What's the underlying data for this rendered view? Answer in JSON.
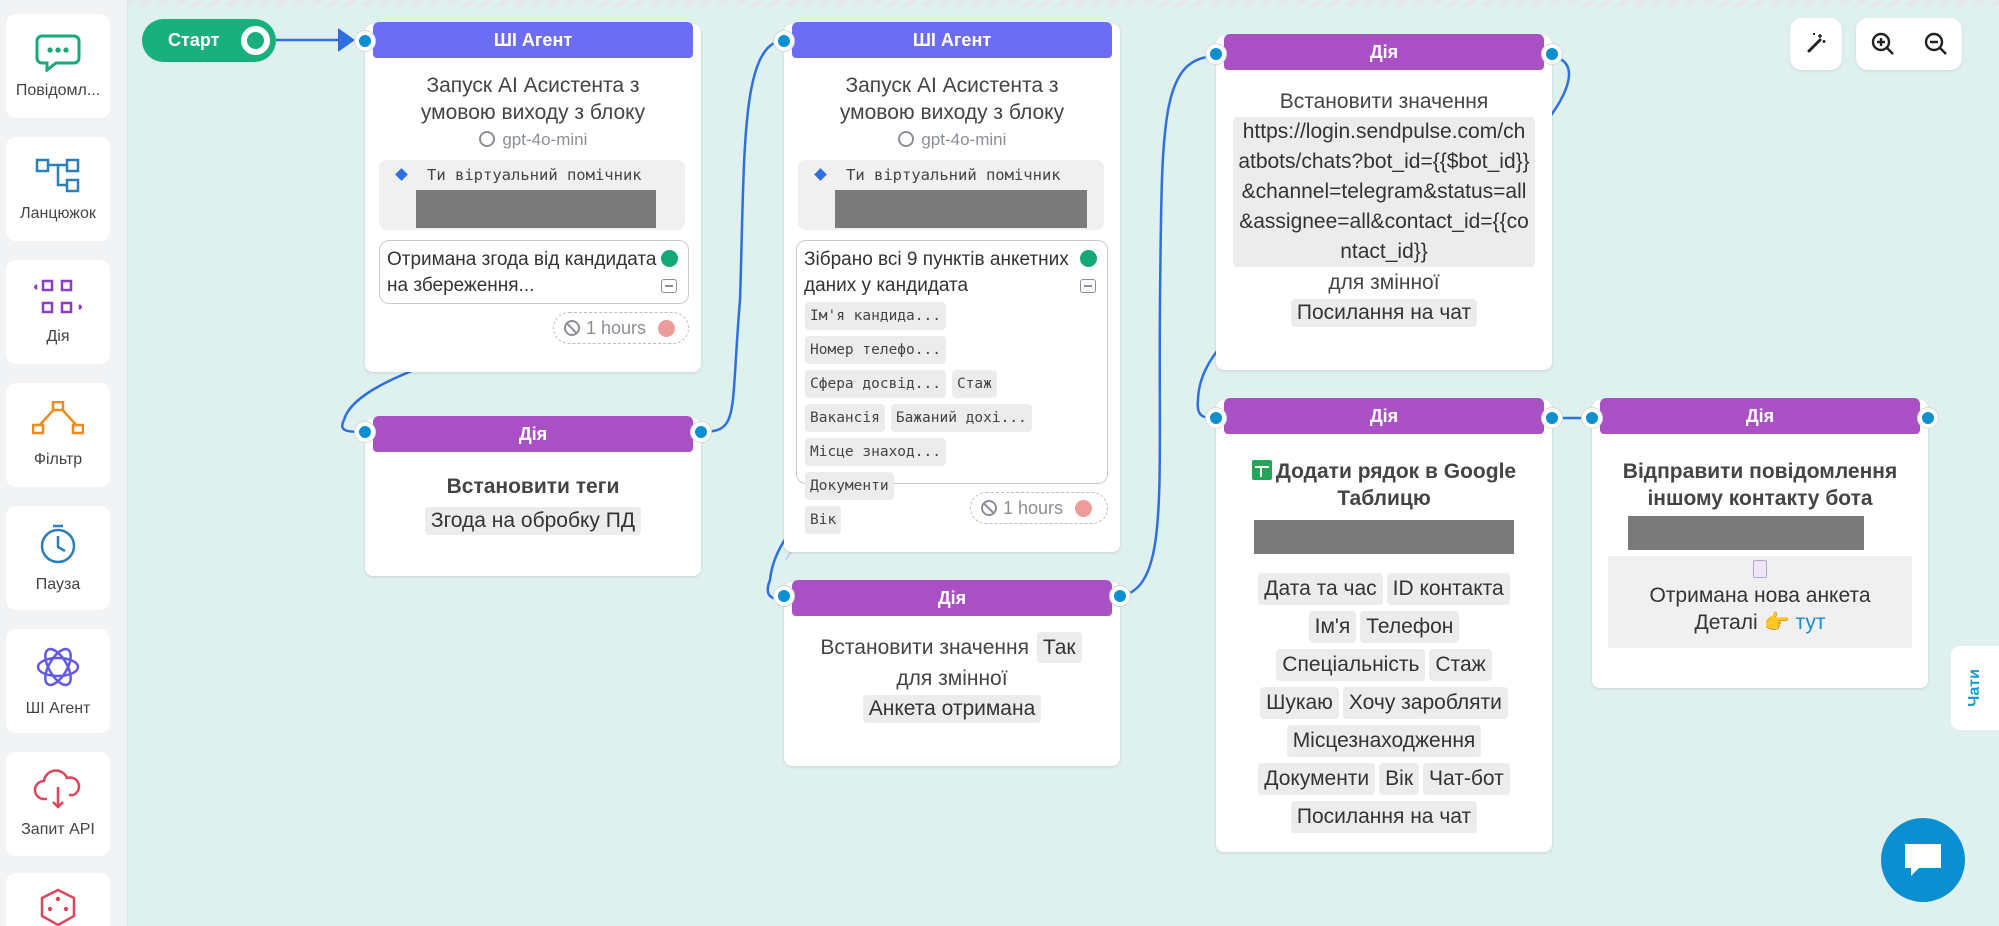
{
  "sidebar": {
    "items": [
      {
        "label": "Повідомл...",
        "icon": "message-icon"
      },
      {
        "label": "Ланцюжок",
        "icon": "chain-icon"
      },
      {
        "label": "Дія",
        "icon": "action-icon"
      },
      {
        "label": "Фільтр",
        "icon": "filter-icon"
      },
      {
        "label": "Пауза",
        "icon": "pause-clock-icon"
      },
      {
        "label": "ШІ Агент",
        "icon": "ai-agent-icon"
      },
      {
        "label": "Запит API",
        "icon": "api-request-icon"
      },
      {
        "label": "",
        "icon": "random-dice-icon"
      }
    ]
  },
  "start": {
    "label": "Старт"
  },
  "cards": {
    "ai1": {
      "header": "ШІ Агент",
      "title": "Запуск AI Асистента з умовою виходу з блоку",
      "model": "gpt-4o-mini",
      "prompt": "Ти віртуальний помічник",
      "condition": "Отримана згода від кандидата на збереження...",
      "timeout": "1 hours"
    },
    "ai2": {
      "header": "ШІ Агент",
      "title": "Запуск AI Асистента з умовою виходу з блоку",
      "model": "gpt-4o-mini",
      "prompt": "Ти віртуальний помічник",
      "condition": "Зібрано всі 9 пунктів анкетних даних у кандидата",
      "chips": [
        "Ім'я кандида...",
        "Номер телефо...",
        "Сфера досвід...",
        "Стаж",
        "Вакансія",
        "Бажаний дохі...",
        "Місце знаход...",
        "Документи",
        "Вік"
      ],
      "timeout": "1 hours"
    },
    "tags": {
      "header": "Дія",
      "title": "Встановити теги",
      "tag": "Згода на обробку ПД"
    },
    "setval1": {
      "header": "Дія",
      "prefix": "Встановити значення",
      "value": "Так",
      "middle": "для змінної",
      "variable": "Анкета отримана"
    },
    "setval2": {
      "header": "Дія",
      "prefix": "Встановити значення",
      "value": "https://login.sendpulse.com/chatbots/chats?bot_id={{$bot_id}}&channel=telegram&status=all&assignee=all&contact_id={{contact_id}}",
      "middle": "для змінної",
      "variable": "Посилання на чат"
    },
    "gsheet": {
      "header": "Дія",
      "title": "Додати рядок в Google Таблицю",
      "fields": [
        "Дата та час",
        "ID контакта",
        "Ім'я",
        "Телефон",
        "Спеціальність",
        "Стаж",
        "Шукаю",
        "Хочу заробляти",
        "Місцезнаходження",
        "Документи",
        "Вік",
        "Чат-бот",
        "Посилання на чат"
      ]
    },
    "send": {
      "header": "Дія",
      "title": "Відправити повідомлення іншому контакту бота",
      "message_line1": "Отримана нова анкета",
      "message_details": "Деталі",
      "message_emoji": "👉",
      "message_link": "тут"
    }
  },
  "toolbar": {
    "tools": [
      {
        "name": "magic-wand-icon"
      },
      {
        "name": "zoom-in-icon"
      },
      {
        "name": "zoom-out-icon"
      }
    ]
  },
  "chats_tab": {
    "label": "Чати"
  },
  "colors": {
    "ai_header": "#6c6cf5",
    "action_header": "#a950c4",
    "start": "#1ab07d",
    "port": "#0b8fd1",
    "canvas": "#dff1ef"
  }
}
